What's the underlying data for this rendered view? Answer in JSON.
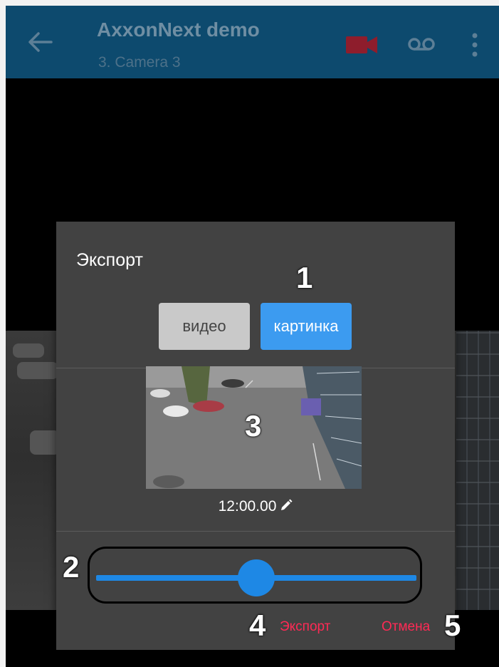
{
  "toolbar": {
    "title": "AxxonNext demo",
    "subtitle": "3. Camera 3",
    "back_icon": "arrow-left-icon",
    "camera_icon": "videocam-icon",
    "camera_icon_color": "#8e1d2c",
    "archive_icon": "voicemail-icon",
    "more_icon": "more-vert-icon",
    "color": "#0d4a6e"
  },
  "dialog": {
    "title": "Экспорт",
    "mode_options": [
      "видео",
      "картинка"
    ],
    "mode_video_label": "видео",
    "mode_picture_label": "картинка",
    "selected_mode": "картинка",
    "timestamp": "12:00.00",
    "edit_icon": "pencil-icon",
    "slider_position": 0.5,
    "export_label": "Экспорт",
    "cancel_label": "Отмена",
    "accent_color": "#1e88e5",
    "action_color": "#ff2a55"
  },
  "callouts": {
    "n1": "1",
    "n2": "2",
    "n3": "3",
    "n4": "4",
    "n5": "5"
  }
}
